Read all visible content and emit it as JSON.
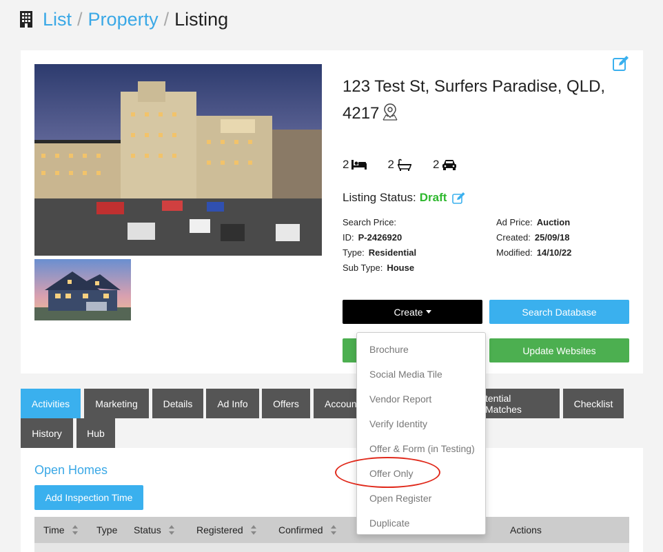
{
  "breadcrumb": {
    "icon": "building-icon",
    "items": [
      "List",
      "Property"
    ],
    "separator": "/",
    "current": "Listing"
  },
  "listing": {
    "address_line1": "123 Test St, Surfers Paradise, QLD,",
    "address_line2": "4217",
    "features": {
      "beds": "2",
      "baths": "2",
      "cars": "2"
    },
    "status_label": "Listing Status:",
    "status_value": "Draft",
    "left_meta": [
      {
        "label": "Search Price:",
        "value": ""
      },
      {
        "label": "ID:",
        "value": "P-2426920"
      },
      {
        "label": "Type:",
        "value": "Residential"
      },
      {
        "label": "Sub Type:",
        "value": "House"
      }
    ],
    "right_meta": [
      {
        "label": "Ad Price:",
        "value": "Auction"
      },
      {
        "label": "Created:",
        "value": "25/09/18"
      },
      {
        "label": "Modified:",
        "value": "14/10/22"
      }
    ]
  },
  "buttons": {
    "create": "Create",
    "search_db": "Search Database",
    "update_websites": "Update Websites"
  },
  "tabs": [
    "Activities",
    "Marketing",
    "Details",
    "Ad Info",
    "Offers",
    "Accoun",
    "tential Matches",
    "Checklist",
    "History",
    "Hub"
  ],
  "active_tab": "Activities",
  "open_homes": {
    "title": "Open Homes",
    "add_button": "Add Inspection Time",
    "columns": [
      "Time",
      "Type",
      "Status",
      "Registered",
      "Confirmed",
      "Actions"
    ]
  },
  "create_menu": [
    "Brochure",
    "Social Media Tile",
    "Vendor Report",
    "Verify Identity",
    "Offer & Form (in Testing)",
    "Offer Only",
    "Open Register",
    "Duplicate"
  ],
  "highlighted_menu_item": "Offer Only",
  "colors": {
    "accent_blue": "#3ab0ee",
    "green": "#4caf50",
    "status_green": "#2eb82e",
    "tab_gray": "#555555",
    "highlight_red": "#e0291b"
  }
}
